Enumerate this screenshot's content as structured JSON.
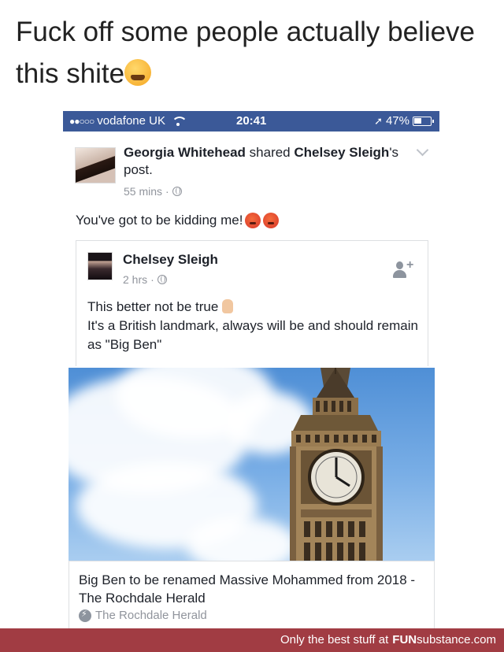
{
  "meme": {
    "caption": "Fuck off some people actually believe this shite"
  },
  "status_bar": {
    "signal": "●●○○○",
    "carrier": "vodafone UK",
    "time": "20:41",
    "battery": "47%"
  },
  "post": {
    "author": "Georgia Whitehead",
    "action": "shared",
    "shared_from": "Chelsey Sleigh",
    "action_suffix": "'s post.",
    "time": "55 mins",
    "text": "You've got to be kidding me!"
  },
  "shared_post": {
    "author": "Chelsey Sleigh",
    "time": "2 hrs",
    "line1": "This better not be true",
    "line2": "It's a British landmark, always will be and should remain as \"Big Ben\""
  },
  "link": {
    "title": "Big Ben to be renamed Massive Mohammed from 2018 - The Rochdale Herald",
    "source": "The Rochdale Herald"
  },
  "watermark": {
    "tagline": "Only the best stuff at",
    "brand_bold": "FUN",
    "brand_rest": "substance.com"
  },
  "colors": {
    "facebook_blue": "#3b5998",
    "footer_red": "#a13c43",
    "meta_grey": "#90949c"
  }
}
